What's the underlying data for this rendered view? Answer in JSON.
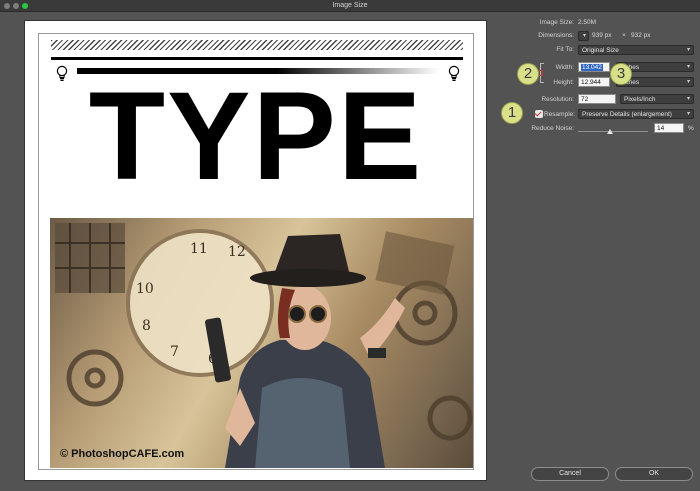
{
  "window": {
    "title": "Image Size"
  },
  "preview": {
    "headline": "TYPE",
    "watermark": "© PhotoshopCAFE.com"
  },
  "panel": {
    "image_size": {
      "label": "Image Size:",
      "value": "2.50M"
    },
    "dimensions": {
      "label": "Dimensions:",
      "width": "939 px",
      "times": "×",
      "height": "932 px"
    },
    "fit_to": {
      "label": "Fit To:",
      "value": "Original Size"
    },
    "width": {
      "label": "Width:",
      "value": "13.042",
      "unit": "Inches"
    },
    "height": {
      "label": "Height:",
      "value": "12.944",
      "unit": "Inches"
    },
    "resolution": {
      "label": "Resolution:",
      "value": "72",
      "unit": "Pixels/Inch"
    },
    "resample": {
      "label": "Resample:",
      "value": "Preserve Details (enlargement)"
    },
    "reduce_noise": {
      "label": "Reduce Noise:",
      "value": "14",
      "unit": "%",
      "level": 0.14
    }
  },
  "badges": [
    "1",
    "2",
    "3"
  ],
  "buttons": {
    "cancel": "Cancel",
    "ok": "OK"
  },
  "colors": {
    "accent_badge": "#d9e08a",
    "selection": "#2f66c6",
    "lock": "#c23a3a"
  },
  "icons": [
    "lightbulb-icon",
    "chain-link-icon",
    "chevron-down-icon",
    "dimensions-options-icon"
  ]
}
